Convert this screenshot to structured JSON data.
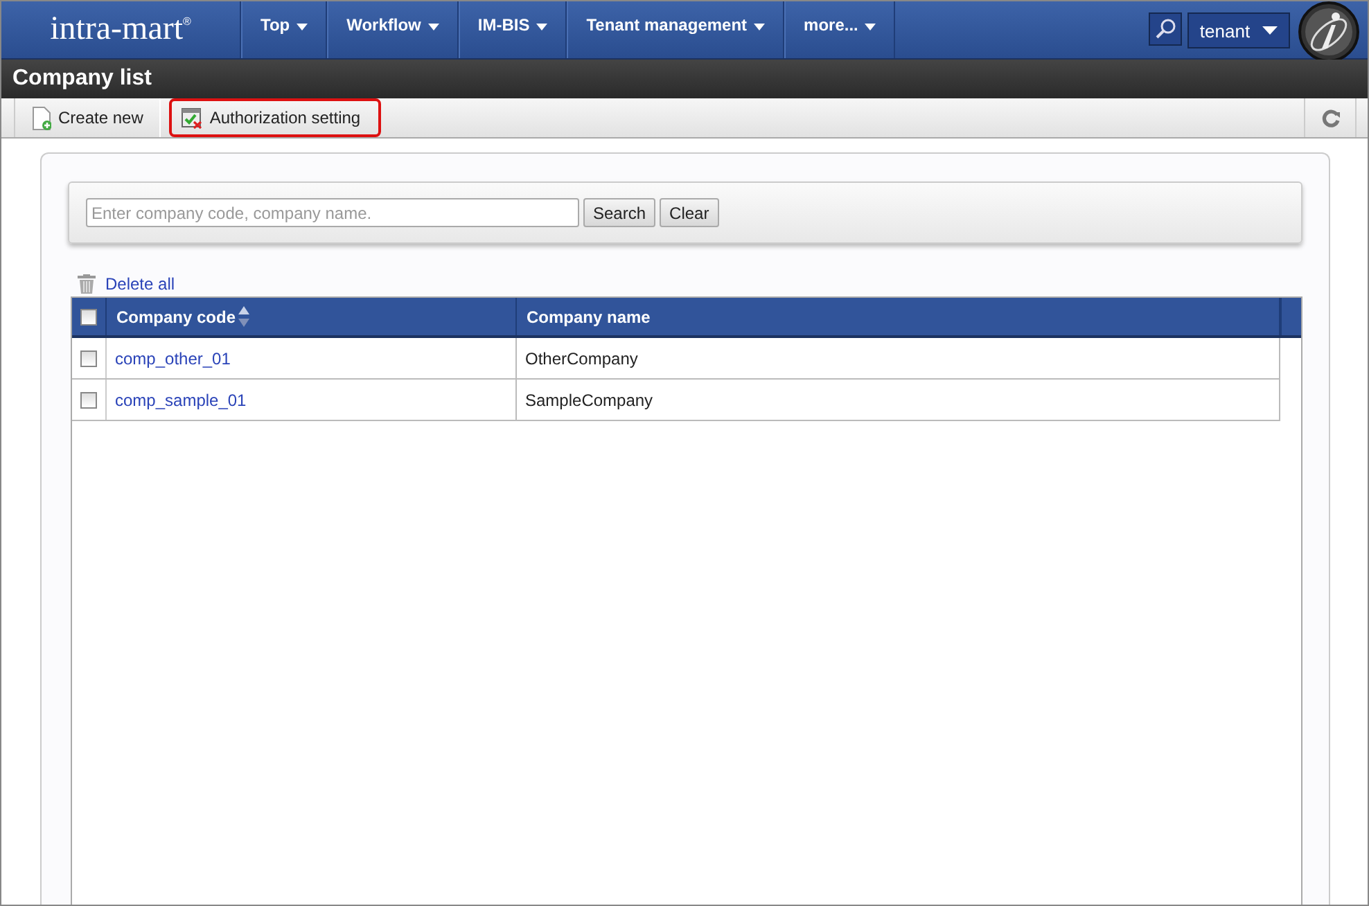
{
  "header": {
    "logo": "intra-mart",
    "logo_mark": "®",
    "menu": [
      {
        "label": "Top"
      },
      {
        "label": "Workflow"
      },
      {
        "label": "IM-BIS"
      },
      {
        "label": "Tenant management"
      },
      {
        "label": "more..."
      }
    ],
    "user": "tenant"
  },
  "page_title": "Company list",
  "toolbar": [
    {
      "label": "Create new",
      "kind": "create",
      "highlighted": false
    },
    {
      "label": "Authorization setting",
      "kind": "auth",
      "highlighted": true
    }
  ],
  "search": {
    "placeholder": "Enter company code, company name.",
    "buttons": [
      "Search",
      "Clear"
    ]
  },
  "delete_all": "Delete all",
  "table": {
    "columns": [
      {
        "label": "Company code",
        "sortable": true
      },
      {
        "label": "Company name",
        "sortable": false
      }
    ],
    "header_checked": false,
    "rows": [
      {
        "code": "comp_other_01",
        "name": "OtherCompany",
        "checked": false
      },
      {
        "code": "comp_sample_01",
        "name": "SampleCompany",
        "checked": false
      }
    ]
  }
}
